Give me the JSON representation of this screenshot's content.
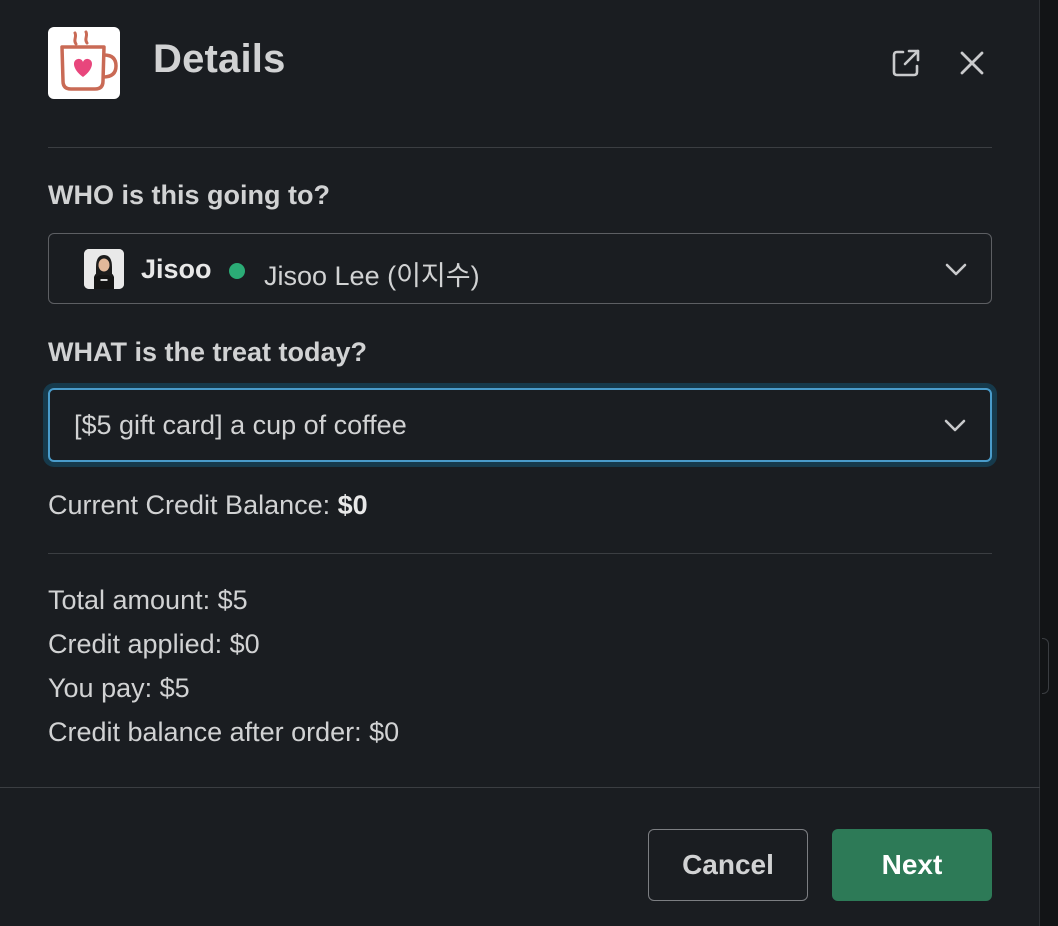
{
  "modal": {
    "title": "Details",
    "popout_icon": "external-link-icon",
    "close_icon": "close-icon"
  },
  "who": {
    "label": "WHO is this going to?",
    "display_name": "Jisoo",
    "full_name": "Jisoo Lee (이지수)",
    "status": "active",
    "status_color": "#2bac76"
  },
  "what": {
    "label": "WHAT is the treat today?",
    "selected": "[$5 gift card] a cup of coffee"
  },
  "balance": {
    "label": "Current Credit Balance: ",
    "value": "$0"
  },
  "summary": {
    "total": "Total amount: $5",
    "credit_applied": "Credit applied: $0",
    "you_pay": "You pay: $5",
    "balance_after": "Credit balance after order: $0"
  },
  "footer": {
    "cancel_label": "Cancel",
    "next_label": "Next"
  },
  "colors": {
    "background": "#1a1d21",
    "accent_focus": "#4a9ccb",
    "primary_button": "#2d7a57",
    "app_icon_heart": "#e8467c",
    "app_icon_cup": "#c96a55"
  }
}
